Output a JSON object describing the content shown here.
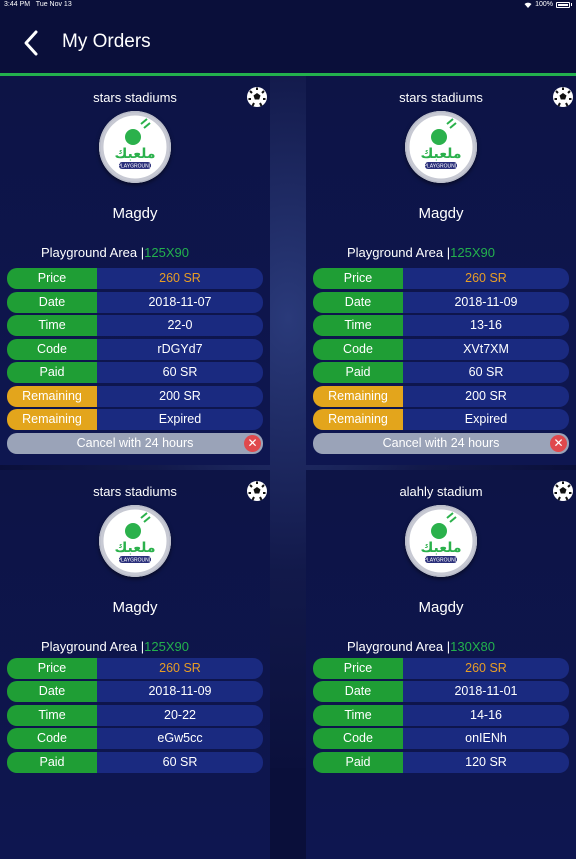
{
  "status": {
    "time": "3:44 PM",
    "date": "Tue Nov 13",
    "battery": "100%"
  },
  "header": {
    "title": "My Orders"
  },
  "colors": {
    "accent_green": "#23b14d",
    "label_green": "#1f9e35",
    "label_orange": "#e3a51c",
    "value_blue": "#1a2a80",
    "price_text": "#e79d25",
    "cancel_bg": "#9aa3b8",
    "cancel_x": "#e0494d"
  },
  "labels": {
    "price": "Price",
    "date": "Date",
    "time": "Time",
    "code": "Code",
    "paid": "Paid",
    "remaining": "Remaining",
    "area": "Playground Area |",
    "cancel": "Cancel with 24 hours",
    "logo_arabic": "ملعبك",
    "logo_text": "PLAYGROUND"
  },
  "orders": [
    {
      "stadium": "stars stadiums",
      "owner": "Magdy",
      "area_size": "125X90",
      "price": "260 SR",
      "date": "2018-11-07",
      "time": "22-0",
      "code": "rDGYd7",
      "paid": "60 SR",
      "remaining": "200 SR",
      "remaining_status": "Expired"
    },
    {
      "stadium": "stars stadiums",
      "owner": "Magdy",
      "area_size": "125X90",
      "price": "260 SR",
      "date": "2018-11-09",
      "time": "13-16",
      "code": "XVt7XM",
      "paid": "60 SR",
      "remaining": "200 SR",
      "remaining_status": "Expired"
    },
    {
      "stadium": "stars stadiums",
      "owner": "Magdy",
      "area_size": "125X90",
      "price": "260 SR",
      "date": "2018-11-09",
      "time": "20-22",
      "code": "eGw5cc",
      "paid": "60 SR"
    },
    {
      "stadium": "alahly stadium",
      "owner": "Magdy",
      "area_size": "130X80",
      "price": "260 SR",
      "date": "2018-11-01",
      "time": "14-16",
      "code": "onIENh",
      "paid": "120 SR"
    }
  ]
}
